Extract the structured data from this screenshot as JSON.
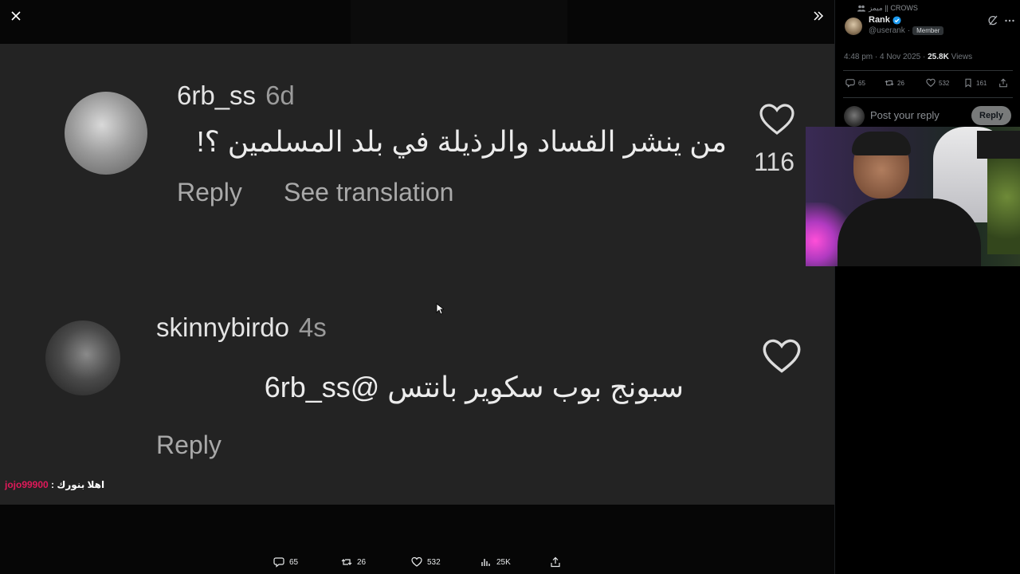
{
  "viewer": {
    "close_icon": "close-icon",
    "expand_icon": "expand-icon"
  },
  "comments": [
    {
      "username": "6rb_ss",
      "age": "6d",
      "text": "من ينشر الفساد والرذيلة في بلد المسلمين ؟!",
      "reply_label": "Reply",
      "translate_label": "See translation",
      "likes": "116"
    },
    {
      "username": "skinnybirdo",
      "age": "4s",
      "text": "سبونج بوب سكوير بانتس @6rb_ss",
      "reply_label": "Reply",
      "likes": ""
    }
  ],
  "chat": {
    "user": "jojo99900",
    "separator": " : ",
    "message": "اهلا بنورك"
  },
  "bottom_actions": {
    "replies": "65",
    "reposts": "26",
    "likes": "532",
    "views": "25K"
  },
  "sidebar": {
    "community": "ميمز || CROWS",
    "author_name": "Rank",
    "author_handle": "@userank",
    "separator": "·",
    "member_badge": "Member",
    "time": "4:48 pm",
    "date": "4 Nov 2025",
    "views_count": "25.8K",
    "views_label": "Views",
    "actions": {
      "replies": "65",
      "reposts": "26",
      "likes": "532",
      "bookmarks": "161"
    },
    "reply_placeholder": "Post your reply",
    "reply_button": "Reply"
  },
  "colors": {
    "accent_blue": "#1d9bf0",
    "chat_user": "#e0195a",
    "video_bg": "#232323"
  }
}
